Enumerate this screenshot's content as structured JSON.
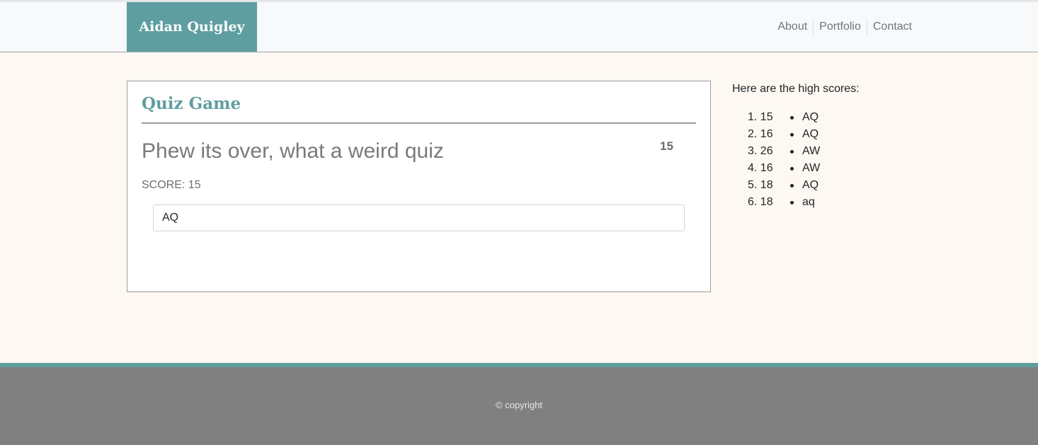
{
  "nav": {
    "brand": "Aidan Quigley",
    "links": [
      "About",
      "Portfolio",
      "Contact"
    ]
  },
  "quiz": {
    "title": "Quiz Game",
    "question": "Phew its over, what a weird quiz",
    "timer": "15",
    "score_text": "SCORE: 15",
    "initials_value": "AQ"
  },
  "scores": {
    "heading": "Here are the high scores:",
    "items": [
      {
        "num": "1.",
        "score": "15",
        "name": "AQ"
      },
      {
        "num": "2.",
        "score": "16",
        "name": "AQ"
      },
      {
        "num": "3.",
        "score": "26",
        "name": "AW"
      },
      {
        "num": "4.",
        "score": "16",
        "name": "AW"
      },
      {
        "num": "5.",
        "score": "18",
        "name": "AQ"
      },
      {
        "num": "6.",
        "score": "18",
        "name": "aq"
      }
    ]
  },
  "footer": {
    "copyright": "© copyright"
  },
  "colors": {
    "accent": "#5f9ea0",
    "page_background": "#fdf8f1",
    "footer_background": "#808080"
  }
}
